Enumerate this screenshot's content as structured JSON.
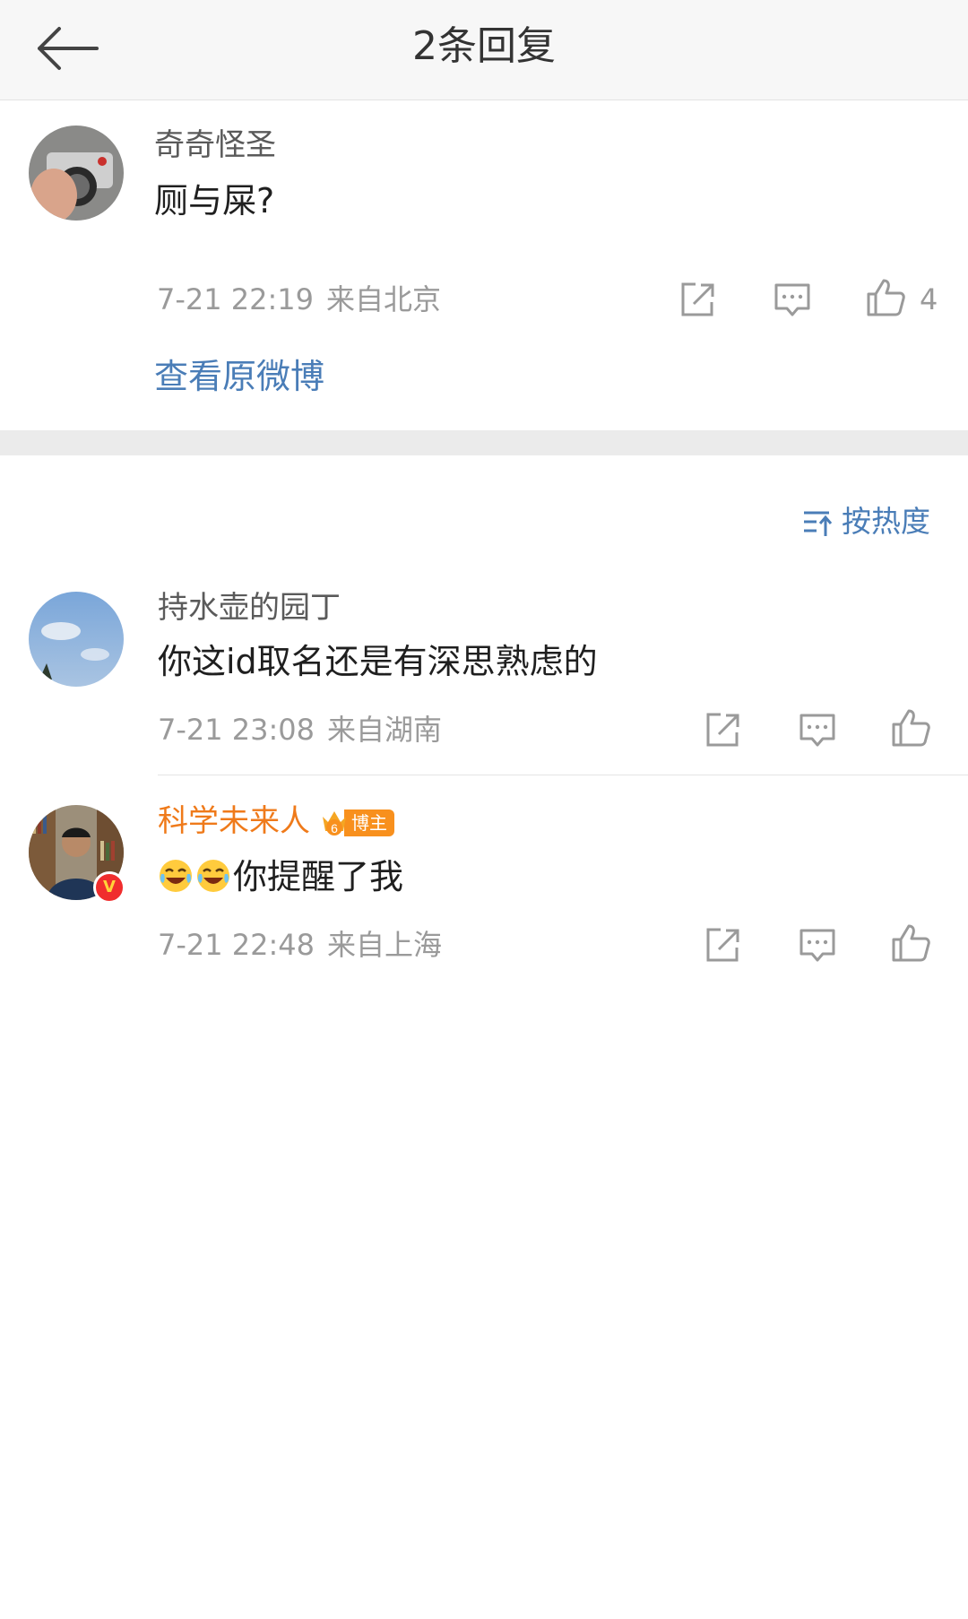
{
  "header": {
    "title": "2条回复"
  },
  "root_comment": {
    "username": "奇奇怪圣",
    "text": "厕与屎?",
    "time": "7-21 22:19",
    "location": "来自北京",
    "like_count": "4",
    "view_original_label": "查看原微博"
  },
  "sort": {
    "label": "按热度"
  },
  "replies": [
    {
      "username": "持水壶的园丁",
      "text": "你这id取名还是有深思熟虑的",
      "time": "7-21 23:08",
      "location": "来自湖南"
    },
    {
      "username": "科学未来人",
      "badge_level": "6",
      "badge_label": "博主",
      "emoji_icon": "laugh-cry-emoji",
      "text": "你提醒了我",
      "time": "7-21 22:48",
      "location": "来自上海"
    }
  ],
  "colors": {
    "link": "#4a7db7",
    "vip_name": "#ef7a1a",
    "meta": "#9a9a9a"
  }
}
